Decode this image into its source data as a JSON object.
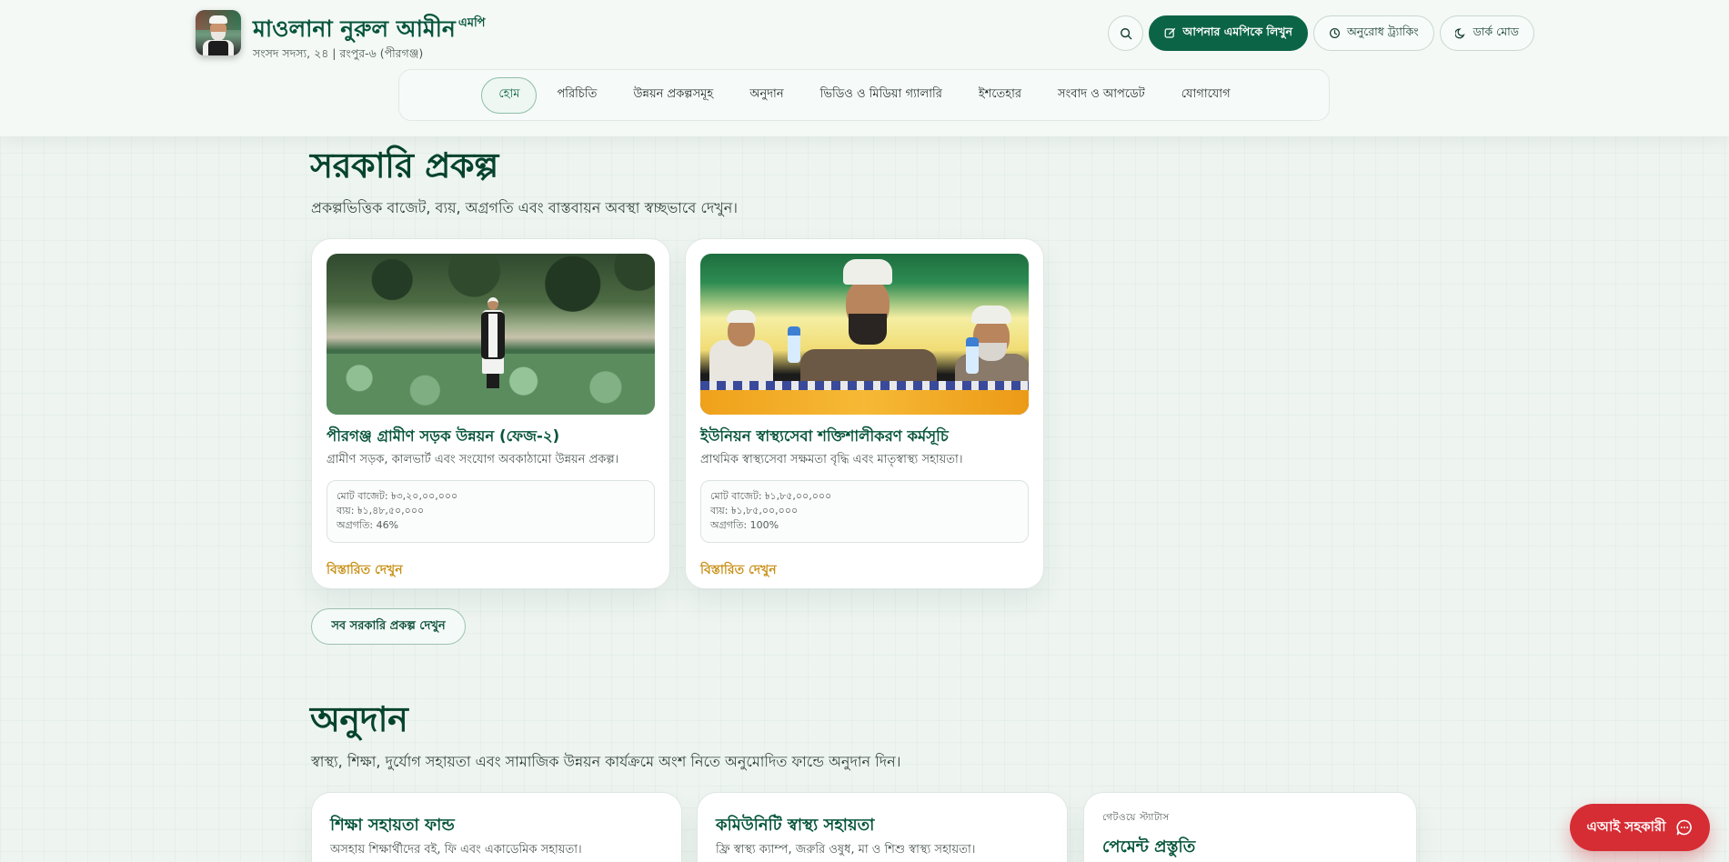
{
  "header": {
    "name": "মাওলানা নুরুল আমীন",
    "name_suffix": "এমপি",
    "subtitle": "সংসদ সদস্য, ২৪ | রংপুর-৬ (পীরগঞ্জ)",
    "actions": {
      "write_label": "আপনার এমপিকে লিখুন",
      "track_label": "অনুরোধ ট্র্যাকিং",
      "dark_label": "ডার্ক মোড"
    },
    "nav": [
      "হোম",
      "পরিচিতি",
      "উন্নয়ন প্রকল্পসমূহ",
      "অনুদান",
      "ভিডিও ও মিডিয়া গ্যালারি",
      "ইশতেহার",
      "সংবাদ ও আপডেট",
      "যোগাযোগ"
    ],
    "active_nav": "হোম"
  },
  "projects": {
    "title": "সরকারি প্রকল্প",
    "description": "প্রকল্পভিত্তিক বাজেট, ব্যয়, অগ্রগতি এবং বাস্তবায়ন অবস্থা স্বচ্ছভাবে দেখুন।",
    "cards": [
      {
        "title": "পীরগঞ্জ গ্রামীণ সড়ক উন্নয়ন (ফেজ-২)",
        "description": "গ্রামীণ সড়ক, কালভার্ট এবং সংযোগ অবকাঠামো উন্নয়ন প্রকল্প।",
        "budget": "মোট বাজেট: ৳৩,২০,০০,০০০",
        "spent": "ব্যয়: ৳১,৪৮,৫০,০০০",
        "progress": "অগ্রগতি: 46%",
        "more": "বিস্তারিত দেখুন"
      },
      {
        "title": "ইউনিয়ন স্বাস্থ্যসেবা শক্তিশালীকরণ কর্মসূচি",
        "description": "প্রাথমিক স্বাস্থ্যসেবা সক্ষমতা বৃদ্ধি এবং মাতৃস্বাস্থ্য সহায়তা।",
        "budget": "মোট বাজেট: ৳১,৮৫,০০,০০০",
        "spent": "ব্যয়: ৳১,৮৫,০০,০০০",
        "progress": "অগ্রগতি: 100%",
        "more": "বিস্তারিত দেখুন"
      }
    ],
    "all_button": "সব সরকারি প্রকল্প দেখুন"
  },
  "donations": {
    "title": "অনুদান",
    "description": "স্বাস্থ্য, শিক্ষা, দুর্যোগ সহায়তা এবং সামাজিক উন্নয়ন কার্যক্রমে অংশ নিতে অনুমোদিত ফান্ডে অনুদান দিন।",
    "cards": [
      {
        "title": "শিক্ষা সহায়তা ফান্ড",
        "description": "অসহায় শিক্ষার্থীদের বই, ফি এবং একাডেমিক সহায়তা।"
      },
      {
        "title": "কমিউনিটি স্বাস্থ্য সহায়তা",
        "description": "ফ্রি স্বাস্থ্য ক্যাম্প, জরুরি ওষুধ, মা ও শিশু স্বাস্থ্য সহায়তা।"
      }
    ],
    "status_label": "গেটওয়ে স্ট্যাটাস",
    "status_value": "পেমেন্ট প্রস্তুতি"
  },
  "ai_button": "এআই সহকারী",
  "icons": {
    "search": "search-icon",
    "write": "edit-icon",
    "track": "clock-icon",
    "dark": "moon-icon",
    "chat": "chat-icon"
  },
  "colors": {
    "brand_green": "#0c6447",
    "title_green": "#06543b",
    "link_gold": "#c9911a",
    "ai_red": "#d62d35"
  }
}
